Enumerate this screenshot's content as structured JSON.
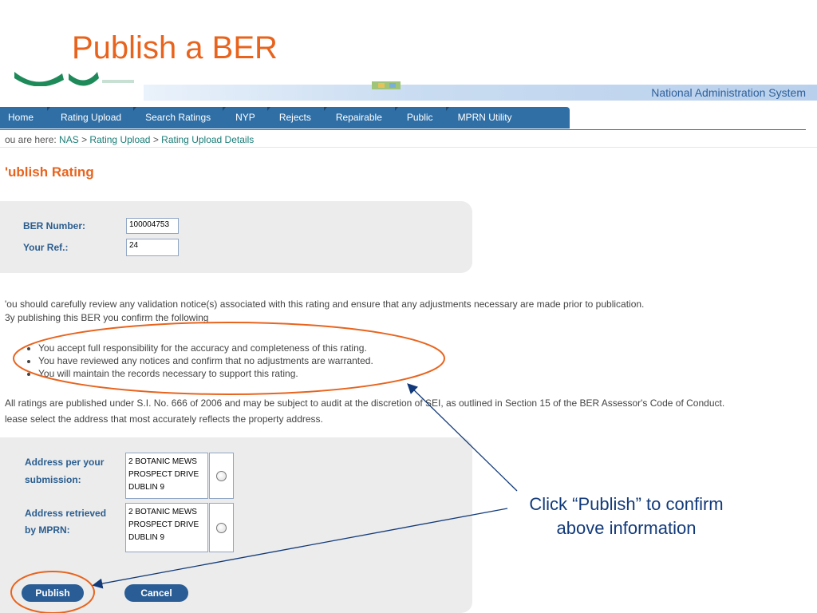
{
  "slide": {
    "title": "Publish a BER"
  },
  "header": {
    "system_name": "National Administration System"
  },
  "nav": {
    "items": [
      "Home",
      "Rating Upload",
      "Search Ratings",
      "NYP",
      "Rejects",
      "Repairable",
      "Public",
      "MPRN Utility"
    ]
  },
  "breadcrumb": {
    "prefix": "ou are here: ",
    "items": [
      "NAS",
      "Rating Upload",
      "Rating Upload Details"
    ],
    "separator": " > "
  },
  "page": {
    "heading": "'ublish Rating"
  },
  "form": {
    "ber_label": "BER Number:",
    "ber_value": "100004753",
    "ref_label": "Your Ref.:",
    "ref_value": "24"
  },
  "notice": {
    "line1": "'ou should carefully review any validation notice(s) associated with this rating and ensure that any adjustments necessary are made prior to publication.",
    "line2": "3y publishing this BER you confirm the following",
    "bullets": [
      "You accept full responsibility for the accuracy and completeness of this rating.",
      "You have reviewed any notices and confirm that no adjustments are warranted.",
      "You will maintain the records necessary to support this rating."
    ],
    "line3": "All ratings are published under S.I. No. 666 of 2006 and may be subject to audit at the discretion of SEI, as outlined in Section 15 of the BER Assessor's Code of Conduct.",
    "line4": "lease select the address that most accurately reflects the property address."
  },
  "address": {
    "submission_label_1": "Address per your",
    "submission_label_2": "submission:",
    "submission_lines": [
      "2 BOTANIC MEWS",
      "PROSPECT DRIVE",
      "DUBLIN 9"
    ],
    "mprn_label_1": "Address retrieved",
    "mprn_label_2": "by MPRN:",
    "mprn_lines": [
      "2 BOTANIC MEWS",
      "PROSPECT DRIVE",
      "DUBLIN 9"
    ]
  },
  "buttons": {
    "publish": "Publish",
    "cancel": "Cancel"
  },
  "callout": {
    "line1": "Click “Publish” to confirm",
    "line2": "above information"
  },
  "colors": {
    "accent_orange": "#e8641e",
    "nav_blue": "#2f6fa6",
    "callout_navy": "#123a7a"
  }
}
